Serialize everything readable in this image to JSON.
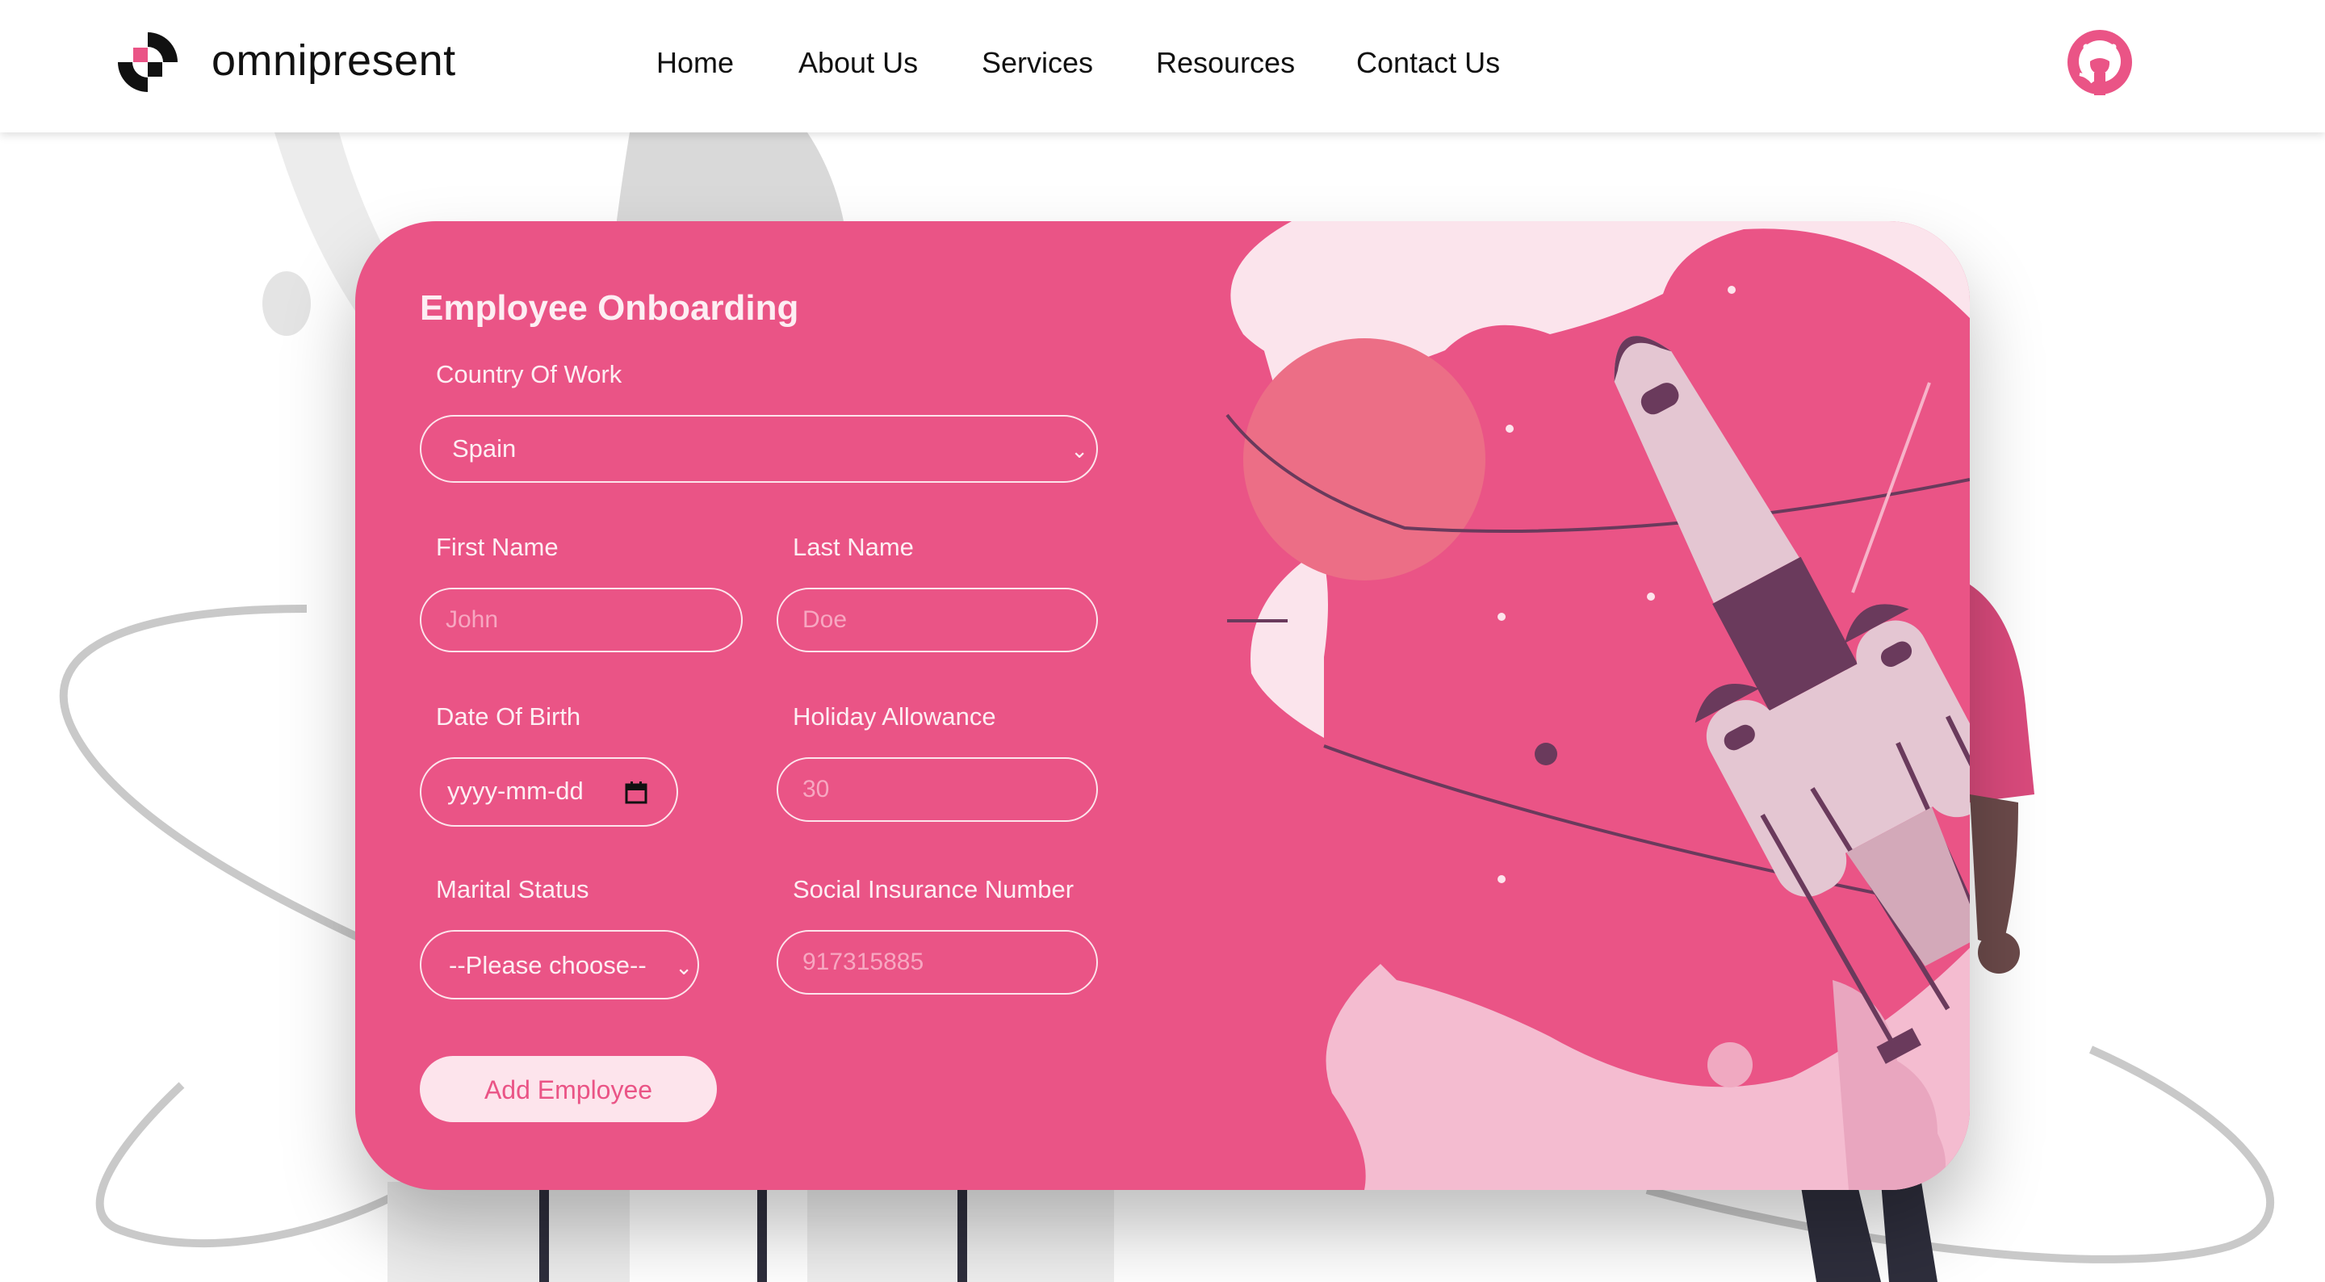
{
  "header": {
    "brand": "omnipresent",
    "nav": [
      "Home",
      "About Us",
      "Services",
      "Resources",
      "Contact Us"
    ],
    "github_icon": "github-icon"
  },
  "form": {
    "title": "Employee Onboarding",
    "country": {
      "label": "Country Of Work",
      "value": "Spain"
    },
    "first_name": {
      "label": "First Name",
      "placeholder": "John"
    },
    "last_name": {
      "label": "Last Name",
      "placeholder": "Doe"
    },
    "dob": {
      "label": "Date Of Birth",
      "value": "yyyy-mm-dd"
    },
    "holiday": {
      "label": "Holiday Allowance",
      "placeholder": "30"
    },
    "marital": {
      "label": "Marital Status",
      "value": "--Please choose--"
    },
    "sin": {
      "label": "Social Insurance Number",
      "placeholder": "917315885"
    },
    "submit": "Add Employee"
  },
  "colors": {
    "accent": "#ea5486",
    "light_pink": "#fde4ec",
    "dark_plum": "#6a3a5c"
  }
}
